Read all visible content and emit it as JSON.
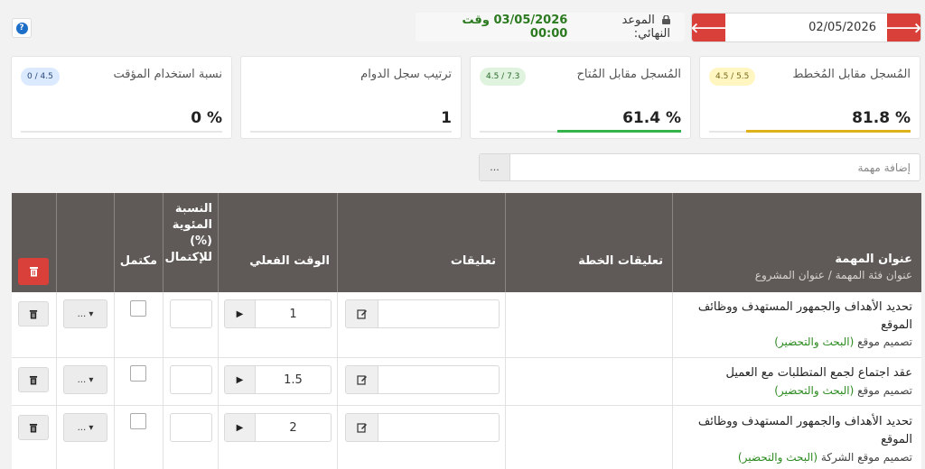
{
  "header": {
    "help_icon": "question-circle-icon",
    "deadline_label": "الموعد النهائي:",
    "deadline_value": "03/05/2026 وقت 00:00",
    "date_value": "02/05/2026"
  },
  "cards": [
    {
      "title": "المُسجل مقابل المُخطط",
      "badge": "4.5 / 5.5",
      "value": "% 81.8",
      "progress": 81.8,
      "bar_color": "#e0b21a",
      "badge_bg": "#fff6c2"
    },
    {
      "title": "المُسجل مقابل المُتاح",
      "badge": "4.5 / 7.3",
      "value": "% 61.4",
      "progress": 61.4,
      "bar_color": "#33b34a",
      "badge_bg": "#dff3df"
    },
    {
      "title": "ترتيب سجل الدوام",
      "value": "1"
    },
    {
      "title": "نسبة استخدام المؤقت",
      "badge": "0 / 4.5",
      "value": "% 0",
      "progress": 0,
      "badge_bg": "#dbeaff"
    }
  ],
  "add_task": {
    "placeholder": "إضافة مهمة",
    "more": "..."
  },
  "table": {
    "headers": {
      "task_title": "عنوان المهمة",
      "task_sub": "عنوان فئة المهمة  / عنوان المشروع",
      "plan_comments": "تعليقات الخطة",
      "comments": "تعليقات",
      "actual_time": "الوقت الفعلي",
      "pct_line1": "النسبة",
      "pct_line2": "المئوية",
      "pct_line3": "(%)",
      "pct_line4": "للإكتمال",
      "completed": "مكتمل"
    },
    "rows": [
      {
        "title": "تحديد الأهداف والجمهور المستهدف ووظائف الموقع",
        "project": "تصميم موقع",
        "category": "(البحث والتحضير)",
        "time": "1",
        "dropdown": "... ▾"
      },
      {
        "title": "عقد اجتماع لجمع المتطلبات مع العميل",
        "project": "تصميم موقع",
        "category": "(البحث والتحضير)",
        "time": "1.5",
        "dropdown": "... ▾"
      },
      {
        "title": "تحديد الأهداف والجمهور المستهدف ووظائف الموقع",
        "project": "تصميم موقع الشركة",
        "category": "(البحث والتحضير)",
        "time": "2",
        "dropdown": "... ▾"
      }
    ]
  }
}
